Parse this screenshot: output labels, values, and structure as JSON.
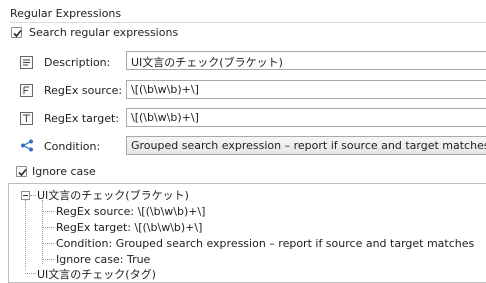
{
  "group": {
    "title": "Regular Expressions"
  },
  "search_regex": {
    "label": "Search regular expressions",
    "checked": true
  },
  "description": {
    "label": "Description:",
    "value": "UI文言のチェック(ブラケット)"
  },
  "regex_source": {
    "label": "RegEx source:",
    "value": "\\[(\\b\\w\\b)+\\]"
  },
  "regex_target": {
    "label": "RegEx target:",
    "value": "\\[(\\b\\w\\b)+\\]"
  },
  "condition": {
    "label": "Condition:",
    "value": "Grouped search expression – report if source and target matches"
  },
  "ignore_case": {
    "label": "Ignore case",
    "checked": true
  },
  "tree": {
    "root_label": "UI文言のチェック(ブラケット)",
    "children": [
      "RegEx source: \\[(\\b\\w\\b)+\\]",
      "RegEx target: \\[(\\b\\w\\b)+\\]",
      "Condition: Grouped search expression – report if source and target matches",
      "Ignore case: True"
    ],
    "next_root_label": "UI文言のチェック(タグ)"
  }
}
